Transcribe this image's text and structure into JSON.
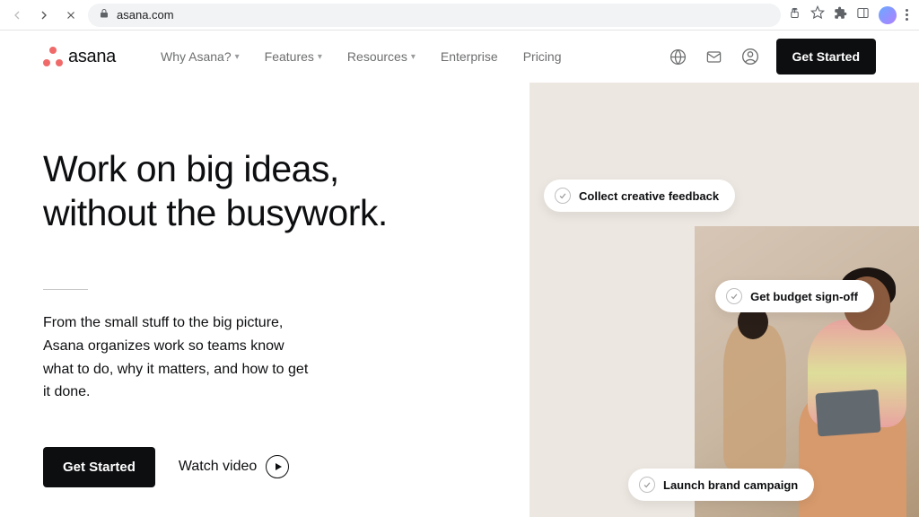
{
  "browser": {
    "url": "asana.com"
  },
  "header": {
    "logo_text": "asana",
    "nav": [
      {
        "label": "Why Asana?",
        "dropdown": true
      },
      {
        "label": "Features",
        "dropdown": true
      },
      {
        "label": "Resources",
        "dropdown": true
      },
      {
        "label": "Enterprise",
        "dropdown": false
      },
      {
        "label": "Pricing",
        "dropdown": false
      }
    ],
    "cta": "Get Started"
  },
  "hero": {
    "headline_line1": "Work on big ideas,",
    "headline_line2": "without the busywork.",
    "subtext": "From the small stuff to the big picture, Asana organizes work so teams know what to do, why it matters, and how to get it done.",
    "cta_primary": "Get Started",
    "cta_video": "Watch video"
  },
  "tasks": [
    "Collect creative feedback",
    "Get budget sign-off",
    "Launch brand campaign"
  ]
}
